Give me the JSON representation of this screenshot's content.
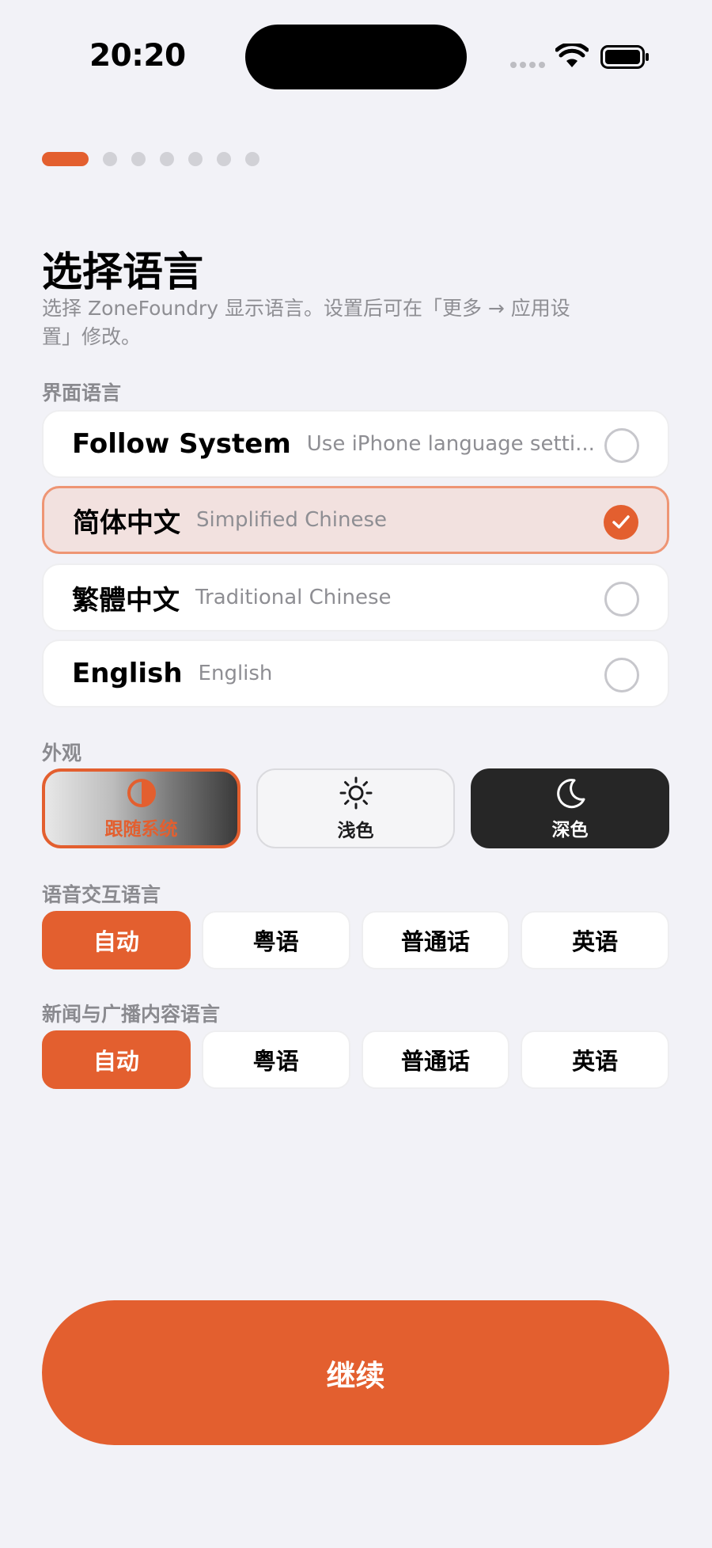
{
  "status_bar": {
    "time": "20:20"
  },
  "onboarding": {
    "total_steps": 7,
    "current_step": 1
  },
  "header": {
    "title": "选择语言",
    "subtitle": "选择 ZoneFoundry 显示语言。设置后可在「更多 → 应用设置」修改。"
  },
  "interface_language": {
    "label": "界面语言",
    "options": [
      {
        "name": "Follow System",
        "desc": "Use iPhone language setti...",
        "selected": false
      },
      {
        "name": "简体中文",
        "desc": "Simplified Chinese",
        "selected": true
      },
      {
        "name": "繁體中文",
        "desc": "Traditional Chinese",
        "selected": false
      },
      {
        "name": "English",
        "desc": "English",
        "selected": false
      }
    ]
  },
  "appearance": {
    "label": "外观",
    "options": [
      {
        "label": "跟随系统",
        "icon": "half-circle-icon",
        "selected": true
      },
      {
        "label": "浅色",
        "icon": "sun-icon",
        "selected": false
      },
      {
        "label": "深色",
        "icon": "moon-icon",
        "selected": false
      }
    ]
  },
  "voice_language": {
    "label": "语音交互语言",
    "options": [
      "自动",
      "粤语",
      "普通话",
      "英语"
    ],
    "selected": "自动"
  },
  "news_language": {
    "label": "新闻与广播内容语言",
    "options": [
      "自动",
      "粤语",
      "普通话",
      "英语"
    ],
    "selected": "自动"
  },
  "continue_label": "继续",
  "colors": {
    "accent": "#e35f2f",
    "background": "#f2f2f7",
    "selected_row": "#f2e1df"
  }
}
